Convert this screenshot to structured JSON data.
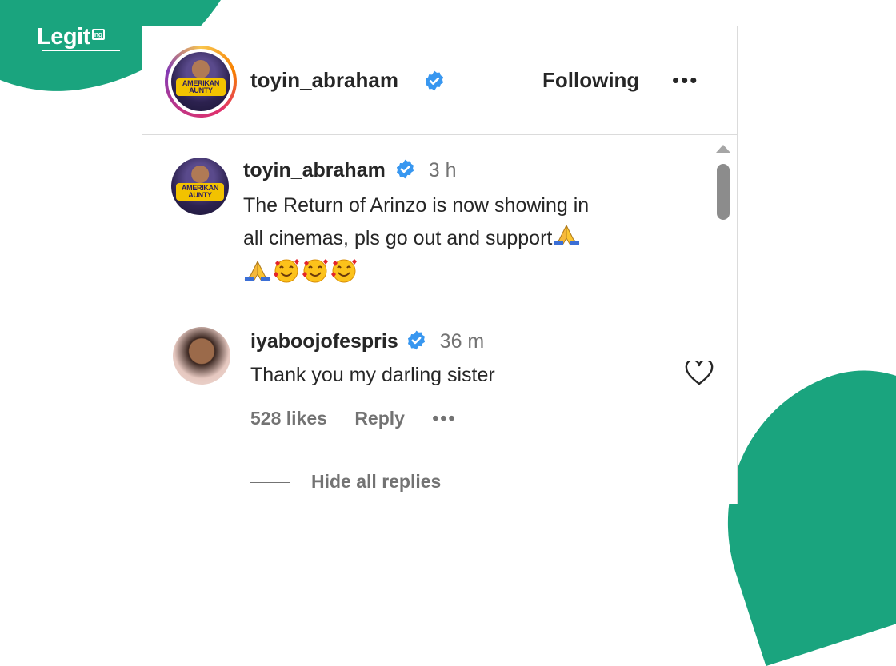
{
  "brand": {
    "name": "Legit",
    "tld": "ng"
  },
  "colors": {
    "brand_green": "#1aa47e",
    "verified_blue": "#3897f0",
    "text": "#262626",
    "muted": "#737373"
  },
  "header": {
    "username": "toyin_abraham",
    "follow_status": "Following",
    "more_icon": "•••",
    "avatar_text": "AMERIKAN AUNTY"
  },
  "caption": {
    "username": "toyin_abraham",
    "time": "3 h",
    "text_line1": "The Return of Arinzo is now showing in",
    "text_line2": "all cinemas, pls go out and support",
    "avatar_text": "AMERIKAN AUNTY"
  },
  "comment": {
    "username": "iyaboojofespris",
    "time": "36 m",
    "text": "Thank you my darling sister",
    "likes": "528 likes",
    "reply_label": "Reply",
    "more_icon": "•••"
  },
  "replies": {
    "toggle_label": "Hide all replies"
  }
}
